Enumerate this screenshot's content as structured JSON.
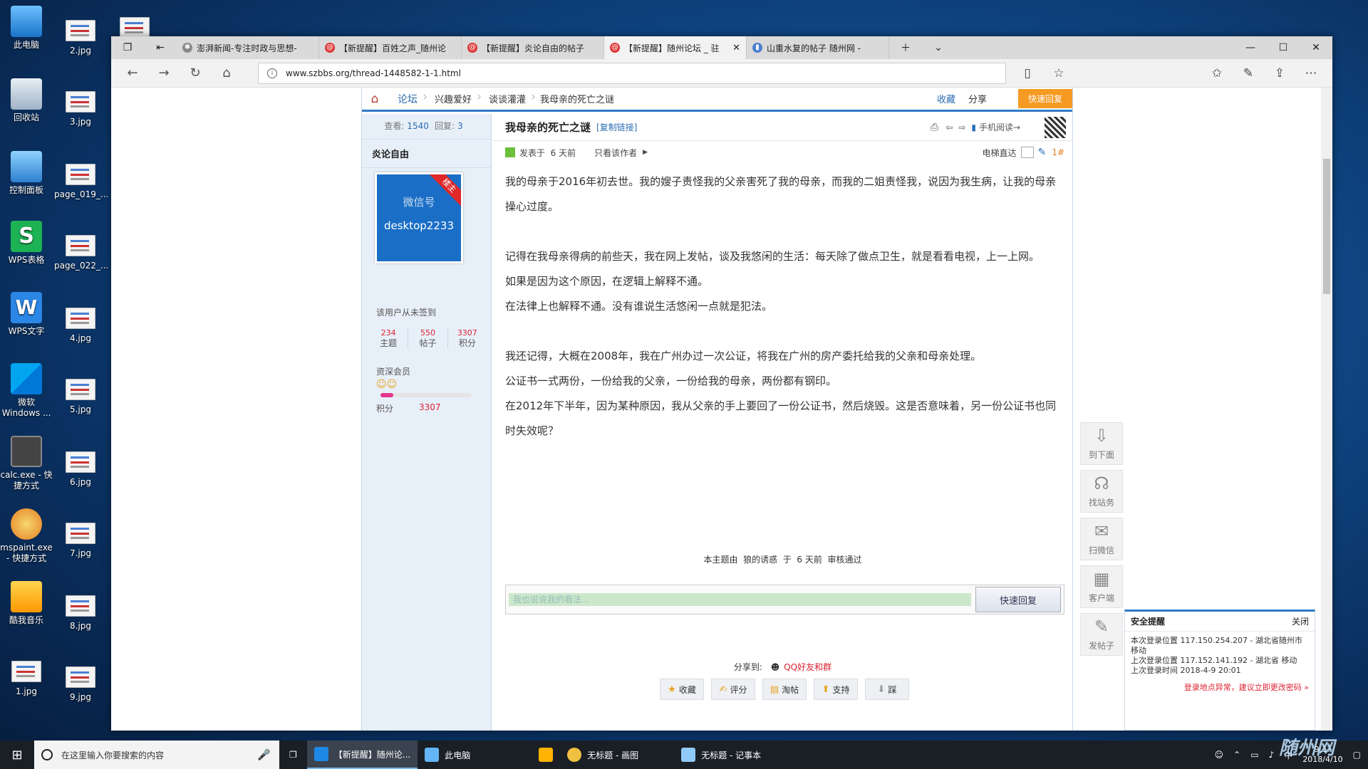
{
  "desktop": {
    "col1": [
      "此电脑",
      "回收站",
      "控制面板",
      "WPS表格",
      "WPS文字",
      "微软\nWindows ...",
      "calc.exe - 快\n捷方式",
      "mspaint.exe\n- 快捷方式",
      "酷我音乐",
      "1.jpg"
    ],
    "col2": [
      "2.jpg",
      "3.jpg",
      "page_019_...",
      "page_022_...",
      "4.jpg",
      "5.jpg",
      "6.jpg",
      "7.jpg",
      "8.jpg",
      "9.jpg"
    ]
  },
  "tabs": [
    {
      "label": "澎湃新闻-专注时政与思想-"
    },
    {
      "label": "【新提醒】百姓之声_随州论"
    },
    {
      "label": "【新提醒】炎论自由的帖子"
    },
    {
      "label": "【新提醒】随州论坛 _ 驻"
    },
    {
      "label": "山重水复的帖子 随州网 -"
    }
  ],
  "address": {
    "url": "www.szbbs.org/thread-1448582-1-1.html"
  },
  "crumb": {
    "forum": "论坛",
    "c1": "兴趣爱好",
    "c2": "谈谈灌灌",
    "c3": "我母亲的死亡之谜",
    "fav": "收藏",
    "share": "分享",
    "qreply": "快速回复"
  },
  "side": {
    "views_label": "查看:",
    "views": "1540",
    "replies_label": "回复:",
    "replies": "3",
    "author": "炎论自由",
    "avatar_l1": "微信号",
    "avatar_l2": "desktop2233",
    "ribbon": "楼主",
    "signin": "该用户从未签到",
    "topics": "234",
    "topics_label": "主题",
    "posts": "550",
    "posts_label": "帖子",
    "points": "3307",
    "points_label": "积分",
    "rank": "资深会员",
    "score_label": "积分",
    "score": "3307"
  },
  "post": {
    "title": "我母亲的死亡之谜",
    "copy": "[复制链接]",
    "mobile": "手机阅读→",
    "posted": "发表于",
    "ago": "6 天前",
    "only": "只看该作者",
    "elevator": "电梯直达",
    "floor": "1#",
    "p1": "我的母亲于2016年初去世。我的嫂子责怪我的父亲害死了我的母亲，而我的二姐责怪我，说因为我生病，让我的母亲操心过度。",
    "p2": "记得在我母亲得病的前些天，我在网上发帖，谈及我悠闲的生活：每天除了做点卫生，就是看看电视，上一上网。",
    "p3": "如果是因为这个原因，在逻辑上解释不通。",
    "p4": "在法律上也解释不通。没有谁说生活悠闲一点就是犯法。",
    "p5": "我还记得，大概在2008年，我在广州办过一次公证，将我在广州的房产委托给我的父亲和母亲处理。",
    "p6": "公证书一式两份，一份给我的父亲，一份给我的母亲，两份都有钢印。",
    "p7": "在2012年下半年，因为某种原因，我从父亲的手上要回了一份公证书，然后烧毁。这是否意味着，另一份公证书也同时失效呢？",
    "moderation": "本主题由  狼的诱惑  于  6 天前  审核通过",
    "reply_ph": "我也说说我的看法...",
    "reply_btn": "快速回复",
    "share_to": "分享到:",
    "qq": "QQ好友和群",
    "actions": [
      "收藏",
      "评分",
      "淘帖",
      "支持",
      "踩"
    ]
  },
  "float": [
    "到下面",
    "找站务",
    "扫微信",
    "客户端",
    "发帖子"
  ],
  "security": {
    "title": "安全提醒",
    "close": "关闭",
    "l1": "本次登录位置  117.150.254.207 - 湖北省随州市 移动",
    "l2": "上次登录位置  117.152.141.192 - 湖北省 移动",
    "l3": "上次登录时间  2018-4-9 20:01",
    "warn": "登录地点异常，建议立即更改密码 »"
  },
  "taskbar": {
    "search": "在这里输入你要搜索的内容",
    "t1": "【新提醒】随州论...",
    "t2": "此电脑",
    "t3": "无标题 - 画图",
    "t4": "无标题 - 记事本",
    "ime": "中",
    "time": "9:1?",
    "date": "2018/4/10"
  },
  "watermark": "随州网"
}
